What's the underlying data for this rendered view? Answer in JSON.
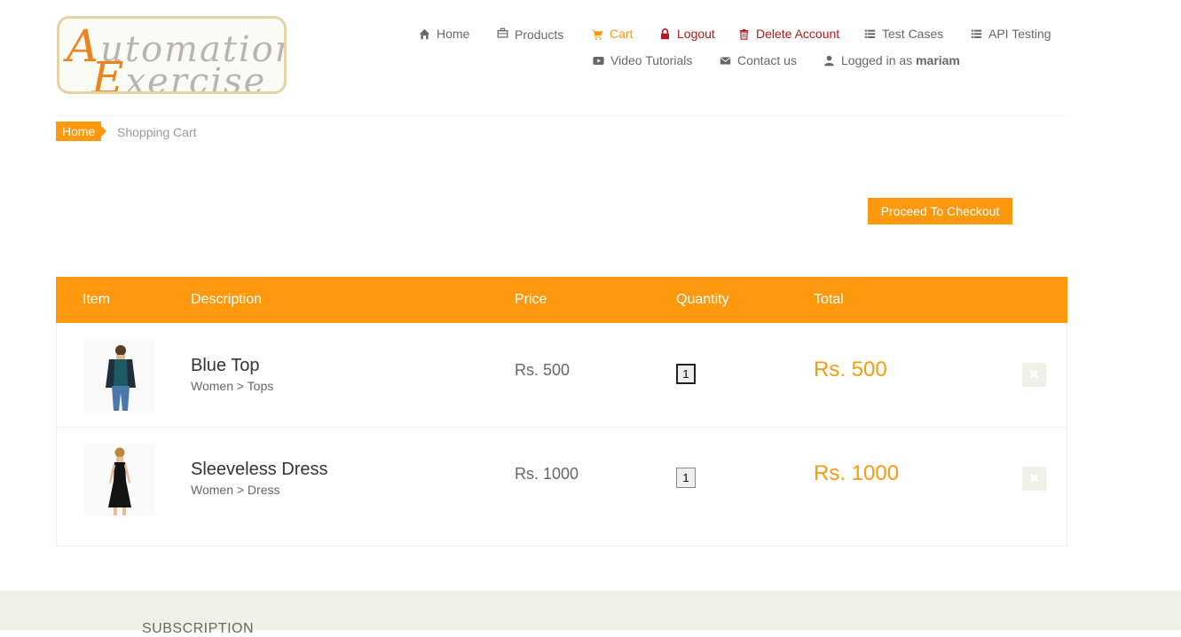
{
  "logo": {
    "line1_cap": "A",
    "line1_rest": "utomation",
    "line2_cap": "E",
    "line2_rest": "xercise"
  },
  "nav": {
    "home": "Home",
    "products": "Products",
    "cart": "Cart",
    "logout": "Logout",
    "delete_account": "Delete Account",
    "test_cases": "Test Cases",
    "api_testing": "API Testing",
    "video_tutorials": "Video Tutorials",
    "contact_us": "Contact us",
    "logged_in_prefix": "Logged in as",
    "username": "mariam"
  },
  "breadcrumb": {
    "home": "Home",
    "current": "Shopping Cart"
  },
  "checkout_button": "Proceed To Checkout",
  "cart": {
    "columns": {
      "item": "Item",
      "description": "Description",
      "price": "Price",
      "quantity": "Quantity",
      "total": "Total"
    },
    "rows": [
      {
        "name": "Blue Top",
        "category": "Women > Tops",
        "price": "Rs. 500",
        "quantity": "1",
        "total": "Rs. 500"
      },
      {
        "name": "Sleeveless Dress",
        "category": "Women > Dress",
        "price": "Rs. 1000",
        "quantity": "1",
        "total": "Rs. 1000"
      }
    ]
  },
  "footer": {
    "subscription_title": "SUBSCRIPTION"
  },
  "colors": {
    "accent": "#fe980f",
    "danger": "#b5171a",
    "text": "#696763",
    "footer_bg": "#f0f0e9"
  },
  "icons": [
    "home-icon",
    "briefcase-icon",
    "cart-icon",
    "lock-icon",
    "trash-icon",
    "list-icon",
    "list-icon",
    "youtube-icon",
    "envelope-icon",
    "user-icon",
    "times-icon"
  ]
}
